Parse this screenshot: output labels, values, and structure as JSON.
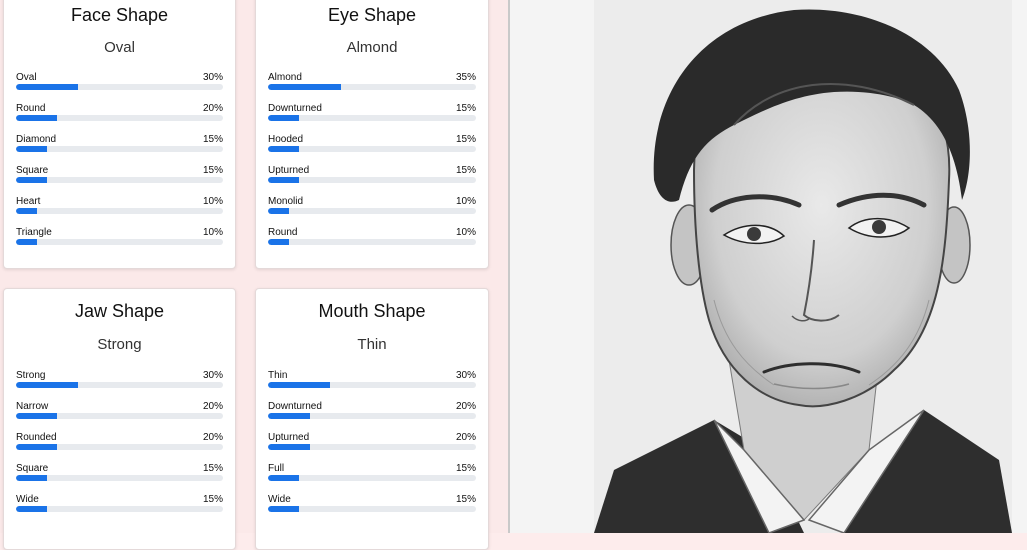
{
  "cards": [
    {
      "title": "Face Shape",
      "value": "Oval",
      "rows": [
        {
          "label": "Oval",
          "pct": "30%",
          "fraction": 0.3
        },
        {
          "label": "Round",
          "pct": "20%",
          "fraction": 0.2
        },
        {
          "label": "Diamond",
          "pct": "15%",
          "fraction": 0.15
        },
        {
          "label": "Square",
          "pct": "15%",
          "fraction": 0.15
        },
        {
          "label": "Heart",
          "pct": "10%",
          "fraction": 0.1
        },
        {
          "label": "Triangle",
          "pct": "10%",
          "fraction": 0.1
        }
      ]
    },
    {
      "title": "Eye Shape",
      "value": "Almond",
      "rows": [
        {
          "label": "Almond",
          "pct": "35%",
          "fraction": 0.35
        },
        {
          "label": "Downturned",
          "pct": "15%",
          "fraction": 0.15
        },
        {
          "label": "Hooded",
          "pct": "15%",
          "fraction": 0.15
        },
        {
          "label": "Upturned",
          "pct": "15%",
          "fraction": 0.15
        },
        {
          "label": "Monolid",
          "pct": "10%",
          "fraction": 0.1
        },
        {
          "label": "Round",
          "pct": "10%",
          "fraction": 0.1
        }
      ]
    },
    {
      "title": "Jaw Shape",
      "value": "Strong",
      "rows": [
        {
          "label": "Strong",
          "pct": "30%",
          "fraction": 0.3
        },
        {
          "label": "Narrow",
          "pct": "20%",
          "fraction": 0.2
        },
        {
          "label": "Rounded",
          "pct": "20%",
          "fraction": 0.2
        },
        {
          "label": "Square",
          "pct": "15%",
          "fraction": 0.15
        },
        {
          "label": "Wide",
          "pct": "15%",
          "fraction": 0.15
        }
      ]
    },
    {
      "title": "Mouth Shape",
      "value": "Thin",
      "rows": [
        {
          "label": "Thin",
          "pct": "30%",
          "fraction": 0.3
        },
        {
          "label": "Downturned",
          "pct": "20%",
          "fraction": 0.2
        },
        {
          "label": "Upturned",
          "pct": "20%",
          "fraction": 0.2
        },
        {
          "label": "Full",
          "pct": "15%",
          "fraction": 0.15
        },
        {
          "label": "Wide",
          "pct": "15%",
          "fraction": 0.15
        }
      ]
    }
  ],
  "colors": {
    "bar_fill": "#1a73e8",
    "bar_track": "#e7eaee",
    "background": "#fbe9e9"
  },
  "photo": {
    "subject": "pencil-sketch-portrait"
  }
}
